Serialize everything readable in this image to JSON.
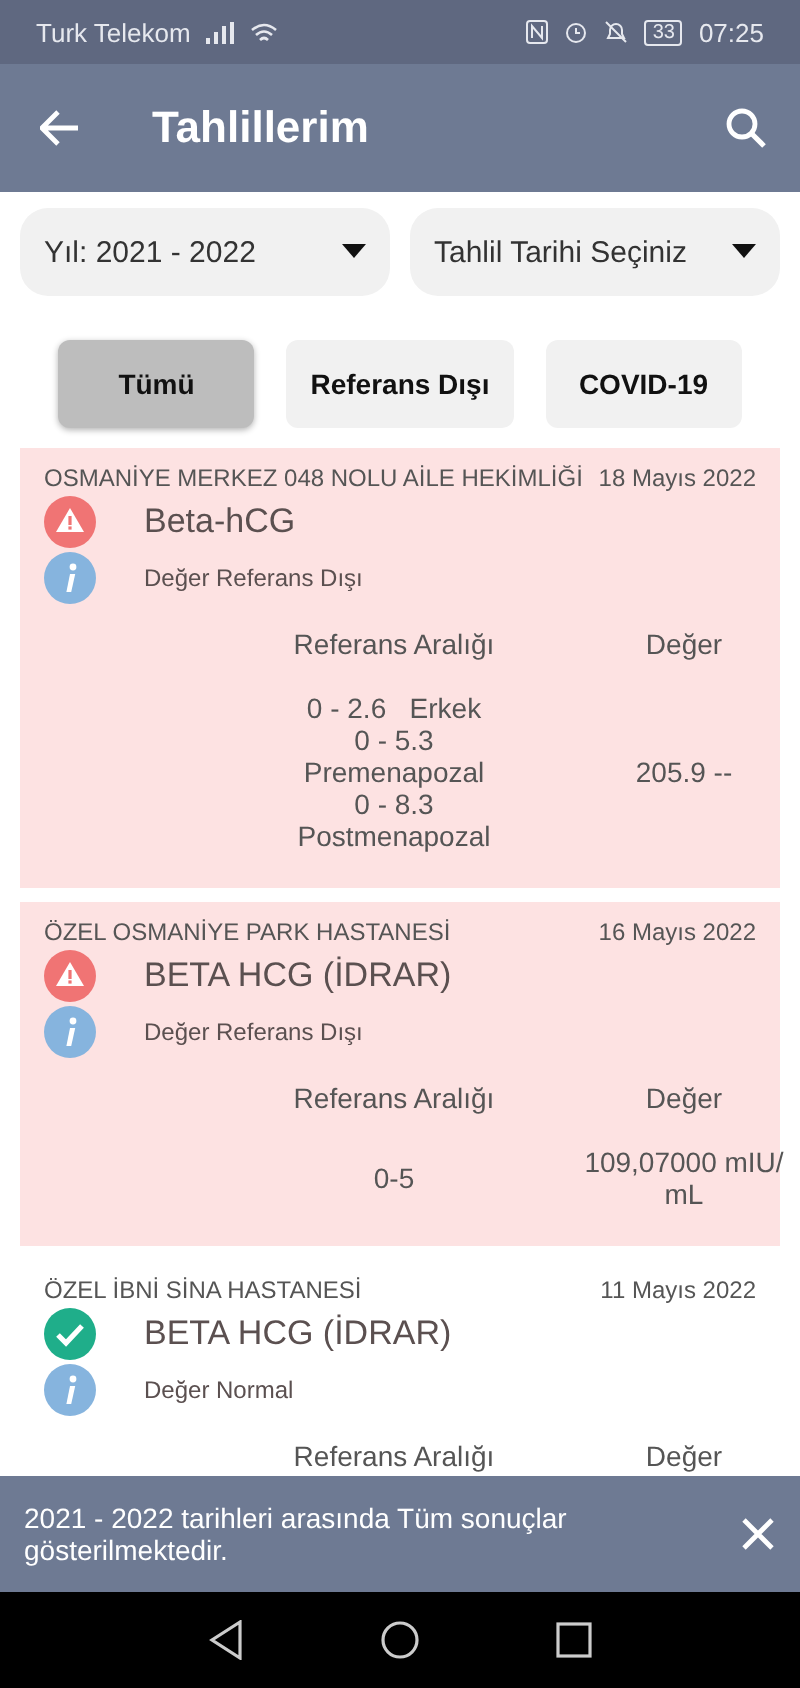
{
  "status_bar": {
    "carrier": "Turk Telekom",
    "battery": "33",
    "time": "07:25"
  },
  "app_bar": {
    "title": "Tahlillerim"
  },
  "filters": [
    {
      "label": "Yıl: 2021 - 2022"
    },
    {
      "label": "Tahlil Tarihi Seçiniz"
    }
  ],
  "tabs": [
    {
      "label": "Tümü",
      "selected": true
    },
    {
      "label": "Referans Dışı",
      "selected": false
    },
    {
      "label": "COVID-19",
      "selected": false
    }
  ],
  "results": [
    {
      "institution": "OSMANİYE MERKEZ 048 NOLU AİLE HEKİMLİĞİ",
      "date": "18 Mayıs 2022",
      "test": "Beta-hCG",
      "kind": "out_of_range",
      "status_text": "Değer Referans Dışı",
      "range_header": "Referans Aralığı",
      "value_header": "Değer",
      "range_lines": [
        "0 - 2.6   Erkek",
        "0 - 5.3",
        "Premenapozal",
        "0 - 8.3",
        "Postmenapozal"
      ],
      "value_lines": [
        "205.9 --"
      ]
    },
    {
      "institution": "ÖZEL OSMANİYE PARK HASTANESİ",
      "date": "16 Mayıs 2022",
      "test": "BETA HCG (İDRAR)",
      "kind": "out_of_range",
      "status_text": "Değer Referans Dışı",
      "range_header": "Referans Aralığı",
      "value_header": "Değer",
      "range_lines": [
        "0-5"
      ],
      "value_lines": [
        "109,07000 mIU/",
        "mL"
      ]
    },
    {
      "institution": "ÖZEL İBNİ SİNA HASTANESİ",
      "date": "11 Mayıs 2022",
      "test": "BETA HCG (İDRAR)",
      "kind": "normal",
      "status_text": "Değer Normal",
      "range_header": "Referans Aralığı",
      "value_header": "Değer"
    }
  ],
  "snackbar": {
    "message": "2021 - 2022 tarihleri arasında Tüm sonuçlar gösterilmektedir."
  }
}
